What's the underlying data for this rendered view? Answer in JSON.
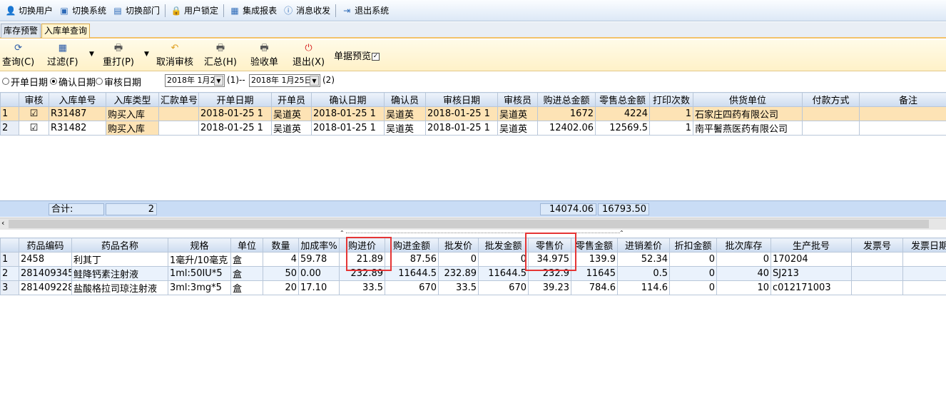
{
  "menu": [
    {
      "icon": "switch-user-icon",
      "label": "切换用户"
    },
    {
      "icon": "switch-system-icon",
      "label": "切换系统"
    },
    {
      "icon": "switch-dept-icon",
      "label": "切换部门"
    },
    {
      "icon": "user-lock-icon",
      "label": "用户锁定"
    },
    {
      "icon": "report-icon",
      "label": "集成报表"
    },
    {
      "icon": "message-icon",
      "label": "消息收发"
    },
    {
      "icon": "exit-system-icon",
      "label": "退出系统"
    }
  ],
  "tabs": [
    "库存预警",
    "入库单查询"
  ],
  "toolbar": {
    "query": "查询(C)",
    "filter": "过滤(F)",
    "reprint": "重打(P)",
    "cancel_audit": "取消审核",
    "summary": "汇总(H)",
    "acceptance": "验收单",
    "exit": "退出(X)",
    "preview_label": "单据预览"
  },
  "filter": {
    "opt1": "开单日期",
    "opt2": "确认日期",
    "opt3": "审核日期",
    "date_from": "2018年 1月2",
    "date_to": "2018年 1月25日",
    "label1": "(1)",
    "sep": "--",
    "label2": "(2)"
  },
  "master": {
    "columns": [
      "",
      "审核",
      "入库单号",
      "入库类型",
      "汇款单号",
      "开单日期",
      "开单员",
      "确认日期",
      "确认员",
      "审核日期",
      "审核员",
      "购进总金额",
      "零售总金额",
      "打印次数",
      "供货单位",
      "付款方式",
      "备注"
    ],
    "rows": [
      {
        "n": "1",
        "audit": "☑",
        "no": "R31487",
        "type": "购买入库",
        "remit": "",
        "open_date": "2018-01-25 1",
        "opener": "吴道英",
        "confirm_date": "2018-01-25 1",
        "confirmer": "吴道英",
        "audit_date": "2018-01-25 1",
        "auditor": "吴道英",
        "buy_total": "1672",
        "retail_total": "4224",
        "prints": "1",
        "supplier": "石家庄四药有限公司",
        "pay": "",
        "remark": ""
      },
      {
        "n": "2",
        "audit": "☑",
        "no": "R31482",
        "type": "购买入库",
        "remit": "",
        "open_date": "2018-01-25 1",
        "opener": "吴道英",
        "confirm_date": "2018-01-25 1",
        "confirmer": "吴道英",
        "audit_date": "2018-01-25 1",
        "auditor": "吴道英",
        "buy_total": "12402.06",
        "retail_total": "12569.5",
        "prints": "1",
        "supplier": "南平鬐燕医药有限公司",
        "pay": "",
        "remark": ""
      }
    ],
    "sum_label": "合计:",
    "sum_count": "2",
    "sum_buy": "14074.06",
    "sum_retail": "16793.50"
  },
  "detail": {
    "columns": [
      "",
      "药品编码",
      "药品名称",
      "规格",
      "单位",
      "数量",
      "加成率%",
      "购进价",
      "购进金额",
      "批发价",
      "批发金额",
      "零售价",
      "零售金额",
      "进销差价",
      "折扣金额",
      "批次库存",
      "生产批号",
      "发票号",
      "发票日期"
    ],
    "rows": [
      {
        "n": "1",
        "code": "2458",
        "name": "利其丁",
        "spec": "1毫升/10毫克",
        "unit": "盒",
        "qty": "4",
        "markup": "59.78",
        "buy_price": "21.89",
        "buy_amt": "87.56",
        "whole_price": "0",
        "whole_amt": "0",
        "retail_price": "34.975",
        "retail_amt": "139.9",
        "diff": "52.34",
        "discount": "0",
        "stock": "0",
        "batch": "170204",
        "invoice": "",
        "inv_date": ""
      },
      {
        "n": "2",
        "code": "281409345",
        "name": "鲑降钙素注射液",
        "spec": "1ml:50IU*5",
        "unit": "盒",
        "qty": "50",
        "markup": "0.00",
        "buy_price": "232.89",
        "buy_amt": "11644.5",
        "whole_price": "232.89",
        "whole_amt": "11644.5",
        "retail_price": "232.9",
        "retail_amt": "11645",
        "diff": "0.5",
        "discount": "0",
        "stock": "40",
        "batch": "SJ213",
        "invoice": "",
        "inv_date": ""
      },
      {
        "n": "3",
        "code": "281409228",
        "name": "盐酸格拉司琼注射液",
        "spec": "3ml:3mg*5",
        "unit": "盒",
        "qty": "20",
        "markup": "17.10",
        "buy_price": "33.5",
        "buy_amt": "670",
        "whole_price": "33.5",
        "whole_amt": "670",
        "retail_price": "39.23",
        "retail_amt": "784.6",
        "diff": "114.6",
        "discount": "0",
        "stock": "10",
        "batch": "c012171003",
        "invoice": "",
        "inv_date": ""
      }
    ]
  }
}
